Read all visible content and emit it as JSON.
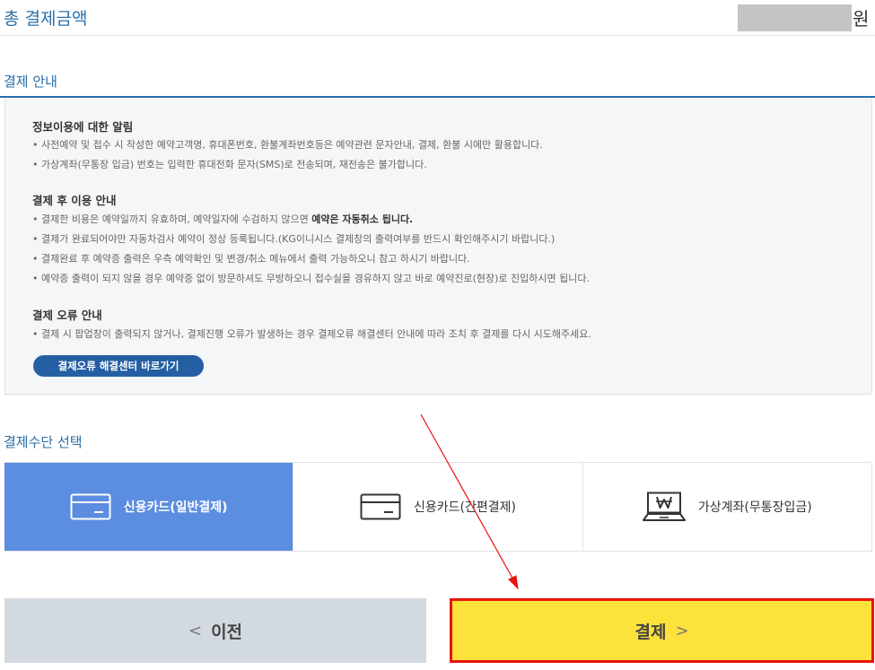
{
  "total": {
    "label": "총 결제금액",
    "unit": "원"
  },
  "guide": {
    "title": "결제 안내",
    "sections": [
      {
        "heading": "정보이용에 대한 알림",
        "lines": [
          "• 사전예약 및 접수 시 작성한 예약고객명, 휴대폰번호, 환불계좌번호등은 예약관련 문자안내, 결제, 환불 시에만 활용합니다.",
          "• 가상계좌(무통장 입금) 번호는 입력한 휴대전화 문자(SMS)로 전송되며, 재전송은 불가합니다."
        ]
      },
      {
        "heading": "결제 후 이용 안내",
        "line1_prefix": "• 결제한 비용은 예약일까지 유효하며, 예약일자에 수검하지 않으면 ",
        "line1_strong": "예약은 자동취소 됩니다.",
        "lines": [
          "• 결제가 완료되어야만 자동차검사 예약이 정상 등록됩니다.(KG이니시스 결제창의 출력여부를 반드시 확인해주시기 바랍니다.)",
          "• 결제완료 후 예약증 출력은 우측 예약확인 및 변경/취소 메뉴에서 출력 가능하오니 참고 하시기 바랍니다.",
          "• 예약증 출력이 되지 않을 경우 예약증 없이 방문하셔도 무방하오니 접수실을 경유하지 않고 바로 예약진로(현장)로 진입하시면 됩니다."
        ]
      },
      {
        "heading": "결제 오류 안내",
        "lines": [
          "• 결제 시 팝업창이 출력되지 않거나, 결제진행 오류가 발생하는 경우 결제오류 해결센터 안내에 따라 조치 후 결제를 다시 시도해주세요."
        ]
      }
    ],
    "error_center_button": "결제오류 해결센터 바로가기"
  },
  "methods": {
    "title": "결제수단 선택",
    "items": [
      {
        "label": "신용카드(일반결제)",
        "icon": "credit-card-icon",
        "selected": true
      },
      {
        "label": "신용카드(간편결제)",
        "icon": "credit-card-icon",
        "selected": false
      },
      {
        "label": "가상계좌(무통장입금)",
        "icon": "laptop-won-icon",
        "selected": false
      }
    ]
  },
  "buttons": {
    "prev": "이전",
    "pay": "결제"
  },
  "colors": {
    "accent": "#2a6fa8",
    "selected_method": "#5b8de0",
    "pay_button": "#fce23b",
    "highlight_border": "#e8140d",
    "annotation_arrow": "#e8140d"
  }
}
